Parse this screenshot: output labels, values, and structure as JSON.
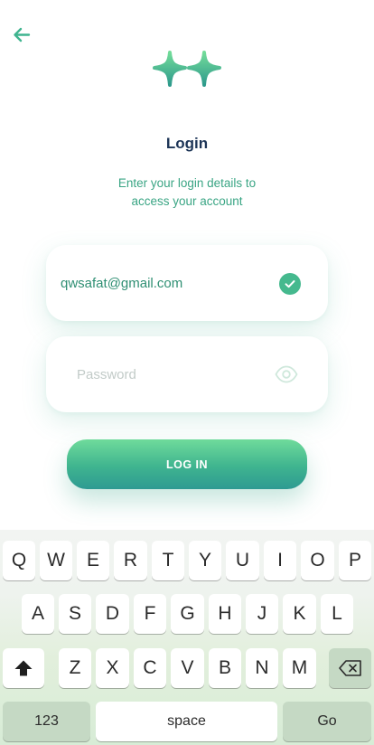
{
  "header": {
    "back_icon": "arrow-left-icon",
    "logo_icon": "sparkle-logo-icon"
  },
  "login": {
    "title": "Login",
    "subtitle_line1": "Enter your login details to",
    "subtitle_line2": "access your account",
    "email_value": "qwsafat@gmail.com",
    "password_placeholder": "Password",
    "email_status_icon": "check-circle-icon",
    "password_toggle_icon": "eye-icon",
    "submit_label": "LOG IN"
  },
  "colors": {
    "accent": "#45b98e",
    "title": "#1d3557",
    "subtitle": "#3aa584"
  },
  "keyboard": {
    "row1": [
      "Q",
      "W",
      "E",
      "R",
      "T",
      "Y",
      "U",
      "I",
      "O",
      "P"
    ],
    "row2": [
      "A",
      "S",
      "D",
      "F",
      "G",
      "H",
      "J",
      "K",
      "L"
    ],
    "row3": [
      "Z",
      "X",
      "C",
      "V",
      "B",
      "N",
      "M"
    ],
    "shift_icon": "shift-arrow-icon",
    "backspace_icon": "backspace-icon",
    "numbers_label": "123",
    "space_label": "space",
    "go_label": "Go"
  }
}
